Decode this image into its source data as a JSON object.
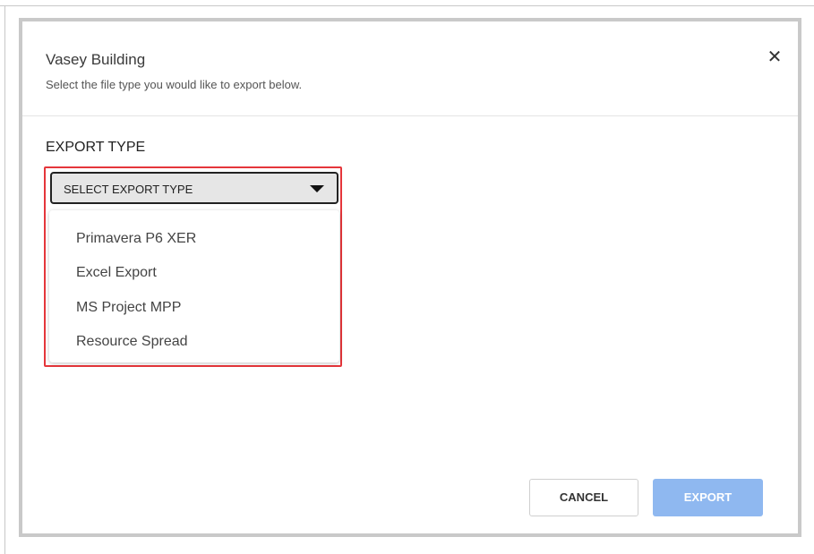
{
  "dialog": {
    "title": "Vasey Building",
    "subtitle": "Select the file type you would like to export below.",
    "close_icon": "close-icon",
    "close_glyph": "✕"
  },
  "export_type": {
    "label": "EXPORT TYPE",
    "select_placeholder": "SELECT EXPORT TYPE",
    "dropdown_icon": "caret-down-icon",
    "options": [
      "Primavera P6 XER",
      "Excel Export",
      "MS Project MPP",
      "Resource Spread"
    ]
  },
  "footer": {
    "cancel_label": "CANCEL",
    "export_label": "EXPORT",
    "export_disabled": true
  },
  "colors": {
    "highlight_border": "#e5363b",
    "export_button_disabled": "#8fb8f0",
    "select_background": "#e6e6e6"
  }
}
